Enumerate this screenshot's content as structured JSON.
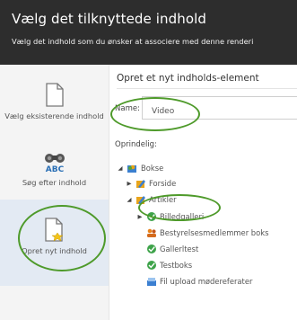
{
  "header": {
    "title": "Vælg det tilknyttede indhold",
    "subtitle": "Vælg det indhold som du ønsker at associere med denne renderi"
  },
  "sidebar": {
    "items": [
      {
        "label": "Vælg eksisterende indhold",
        "icon": "document-icon"
      },
      {
        "label": "Søg efter indhold",
        "icon": "binoculars-abc-icon"
      },
      {
        "label": "Opret nyt indhold",
        "icon": "new-document-icon",
        "active": true
      }
    ]
  },
  "main": {
    "title": "Opret et nyt indholds-element",
    "name_label": "Name:",
    "name_value": "Video",
    "origin_label": "Oprindelig:",
    "tree": [
      {
        "label": "Bokse",
        "icon": "folder-people-icon",
        "expanded": true
      },
      {
        "label": "Forside",
        "icon": "content-item-icon",
        "expanded": false
      },
      {
        "label": "Artikler",
        "icon": "content-item-icon",
        "expanded": true
      },
      {
        "label": "Billedgalleri",
        "icon": "green-item-icon",
        "expanded": false
      },
      {
        "label": "Bestyrelsesmedlemmer boks",
        "icon": "people-icon"
      },
      {
        "label": "Gallerltest",
        "icon": "green-item-icon"
      },
      {
        "label": "Testboks",
        "icon": "green-item-icon"
      },
      {
        "label": "Fil upload mødereferater",
        "icon": "upload-icon"
      }
    ]
  },
  "colors": {
    "header_bg": "#2d2d2d",
    "highlight_ring": "#4e9a2a",
    "active_sidebar": "#e3eaf3"
  }
}
